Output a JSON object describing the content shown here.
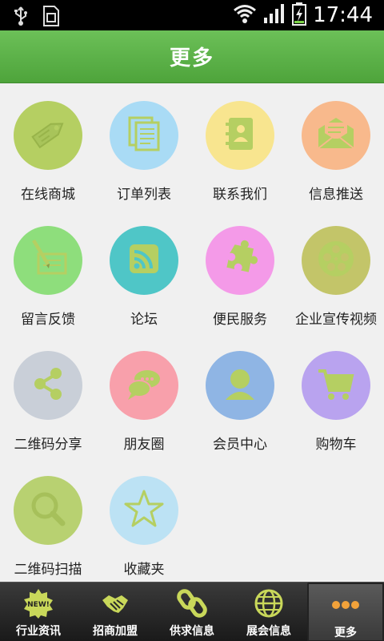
{
  "status_bar": {
    "time": "17:44",
    "icons": [
      "usb-icon",
      "sim-card-icon",
      "wifi-icon",
      "signal-icon",
      "battery-charging-icon"
    ]
  },
  "header": {
    "title": "更多"
  },
  "grid": {
    "items": [
      {
        "label": "在线商城",
        "icon": "price-tag-icon",
        "color": "#b5cf62"
      },
      {
        "label": "订单列表",
        "icon": "documents-icon",
        "color": "#a9dbf5"
      },
      {
        "label": "联系我们",
        "icon": "address-book-icon",
        "color": "#f8e58f"
      },
      {
        "label": "信息推送",
        "icon": "envelope-icon",
        "color": "#f8b98c"
      },
      {
        "label": "留言反馈",
        "icon": "pen-paper-icon",
        "color": "#8ede7c"
      },
      {
        "label": "论坛",
        "icon": "rss-icon",
        "color": "#4fc6c7"
      },
      {
        "label": "便民服务",
        "icon": "puzzle-icon",
        "color": "#f49ae8"
      },
      {
        "label": "企业宣传视频",
        "icon": "film-reel-icon",
        "color": "#c3c569"
      },
      {
        "label": "二维码分享",
        "icon": "share-icon",
        "color": "#c9cfd8"
      },
      {
        "label": "朋友圈",
        "icon": "chat-bubbles-icon",
        "color": "#f8a0ab"
      },
      {
        "label": "会员中心",
        "icon": "user-icon",
        "color": "#8fb5e4"
      },
      {
        "label": "购物车",
        "icon": "shopping-cart-icon",
        "color": "#b9a3ef"
      },
      {
        "label": "二维码扫描",
        "icon": "magnifier-icon",
        "color": "#b8d171"
      },
      {
        "label": "收藏夹",
        "icon": "star-icon",
        "color": "#bce2f4"
      }
    ]
  },
  "bottom_nav": {
    "items": [
      {
        "label": "行业资讯",
        "icon": "new-badge-icon"
      },
      {
        "label": "招商加盟",
        "icon": "handshake-icon"
      },
      {
        "label": "供求信息",
        "icon": "chain-link-icon"
      },
      {
        "label": "展会信息",
        "icon": "globe-icon"
      },
      {
        "label": "更多",
        "icon": "more-dots-icon"
      }
    ],
    "active_label": "更多"
  },
  "colors": {
    "header_green": "#5bb248",
    "icon_glyph": "#b5cf62",
    "background": "#f0f0f0",
    "nav_dark": "#2a2a2a",
    "more_dots": "#f2a23a"
  }
}
